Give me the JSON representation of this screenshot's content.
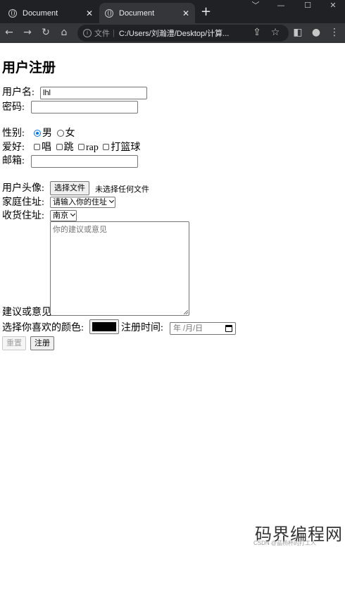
{
  "browser": {
    "tabs": [
      {
        "title": "Document"
      },
      {
        "title": "Document"
      }
    ],
    "new_tab": "+",
    "window_controls": [
      "﹀",
      "—",
      "☐",
      "✕"
    ],
    "address": {
      "protocol_label": "文件",
      "url": "C:/Users/刘瀚澧/Desktop/计算..."
    },
    "icons": [
      "back-icon",
      "forward-icon",
      "reload-icon",
      "home-icon",
      "info-icon",
      "share-icon",
      "star-icon",
      "sidepanel-icon",
      "profile-icon",
      "menu-icon"
    ]
  },
  "form": {
    "title": "用户注册",
    "username": {
      "label": "用户名:",
      "value": "lhl"
    },
    "password": {
      "label": "密码:",
      "value": ""
    },
    "gender": {
      "label": "性别:",
      "options": [
        "男",
        "女"
      ],
      "selected": "男"
    },
    "hobby": {
      "label": "爱好:",
      "options": [
        "唱",
        "跳",
        "rap",
        "打篮球"
      ]
    },
    "email": {
      "label": "邮箱:",
      "value": ""
    },
    "avatar": {
      "label": "用户头像:",
      "button": "选择文件",
      "status": "未选择任何文件"
    },
    "home_address": {
      "label": "家庭住址:",
      "selected": "请输入你的住址"
    },
    "delivery_address": {
      "label": "收货住址:",
      "selected": "南京"
    },
    "suggestion": {
      "label": "建议或意见",
      "placeholder": "你的建议或意见"
    },
    "color": {
      "label": "选择你喜欢的颜色:",
      "value": "#000000"
    },
    "register_time": {
      "label": "注册时间:",
      "placeholder": "年 /月/日"
    },
    "reset_button": "重置",
    "submit_button": "注册"
  },
  "watermark": {
    "text": "码界编程网",
    "small": "CSDN @蓝桥杯的打工人"
  }
}
